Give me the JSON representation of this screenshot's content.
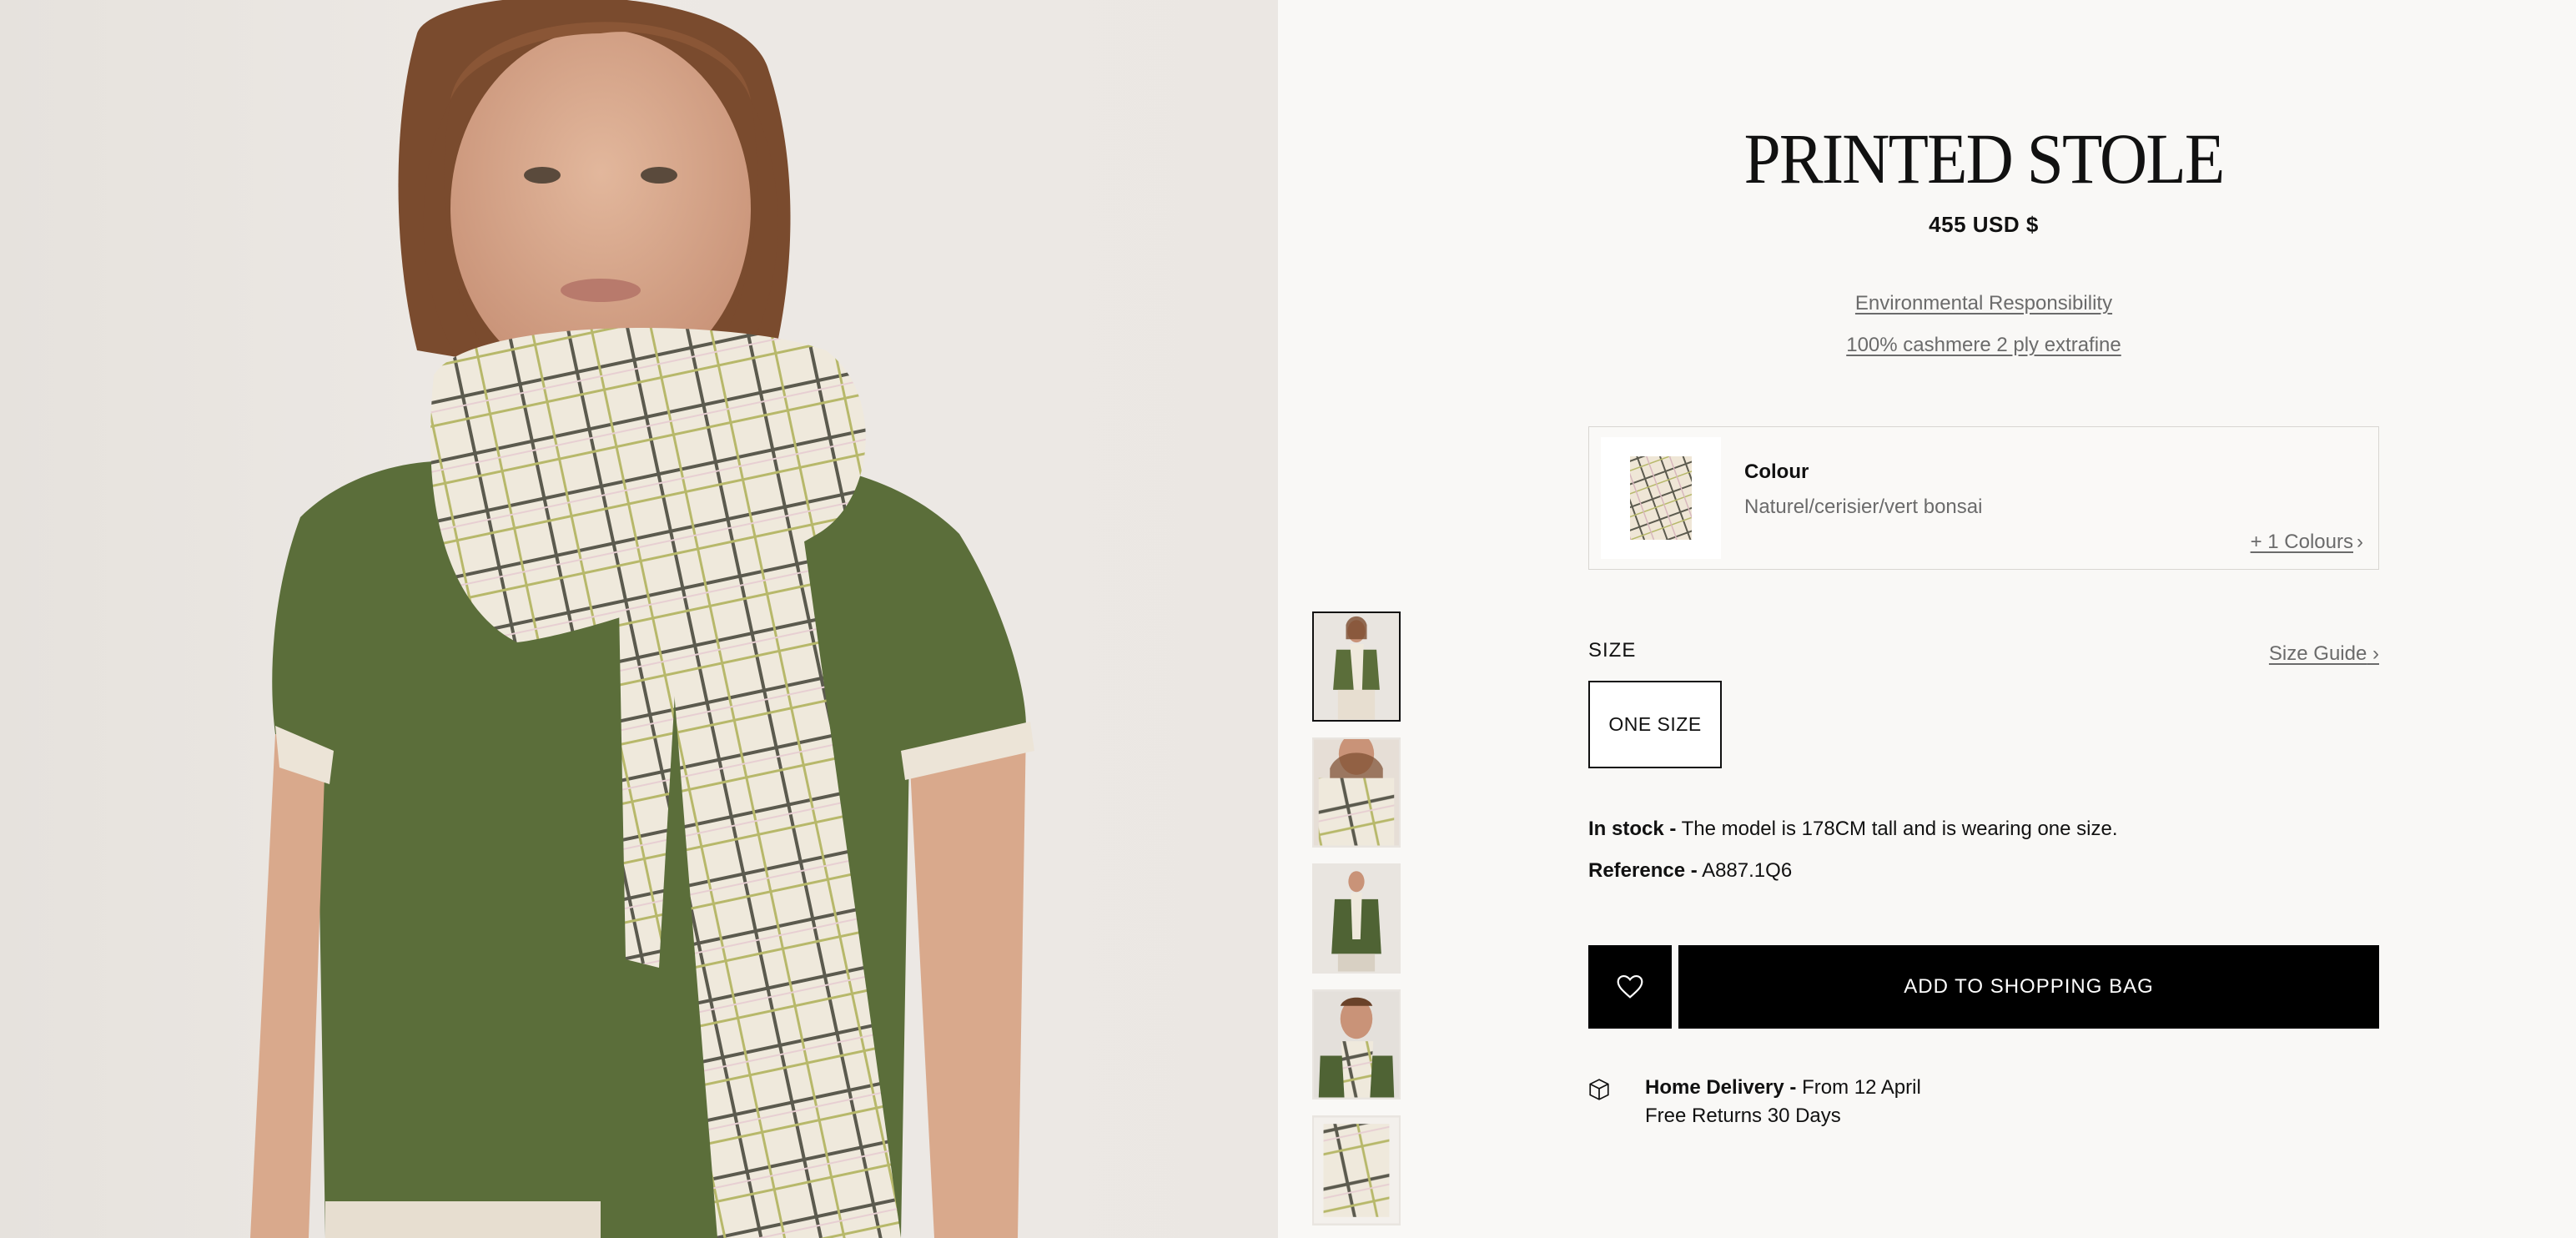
{
  "product": {
    "title": "PRINTED STOLE",
    "price": "455 USD $",
    "environmental_link": "Environmental Responsibility",
    "composition_link": "100% cashmere 2 ply extrafine"
  },
  "colour": {
    "label": "Colour",
    "value": "Naturel/cerisier/vert bonsai",
    "more_link": "+ 1 Colours"
  },
  "size": {
    "label": "SIZE",
    "guide_link": "Size Guide",
    "options": [
      "ONE SIZE"
    ]
  },
  "stock": {
    "status": "In stock -",
    "note": " The model is 178CM tall and is wearing one size."
  },
  "reference": {
    "label": "Reference -",
    "value": " A887.1Q6"
  },
  "actions": {
    "add_to_bag": "ADD TO SHOPPING BAG",
    "wishlist_icon": "heart-icon"
  },
  "delivery": {
    "title": "Home Delivery -",
    "date": " From 12 April",
    "returns": "Free Returns 30 Days",
    "icon": "box-icon"
  },
  "gallery": {
    "thumbnails": [
      "woman-front-view",
      "scarf-closeup",
      "man-front-view",
      "man-closeup",
      "scarf-flat-lay"
    ],
    "active_index": 0
  },
  "colors": {
    "background": "#f9f8f6",
    "button": "#000000",
    "muted_text": "#6b6b6b",
    "border": "#d8d6d2"
  }
}
